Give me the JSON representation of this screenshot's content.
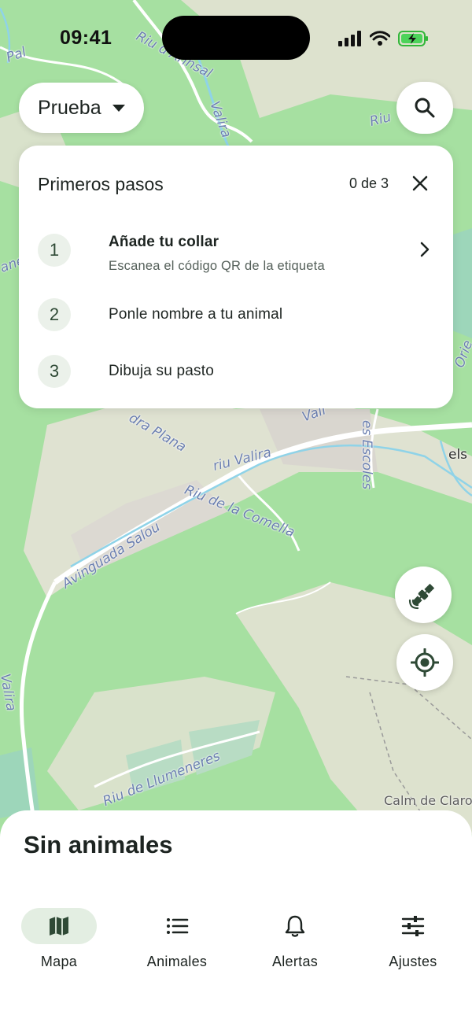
{
  "status_bar": {
    "time": "09:41"
  },
  "farm_selector": {
    "label": "Prueba"
  },
  "onboarding": {
    "title": "Primeros pasos",
    "progress": "0 de 3",
    "steps": [
      {
        "number": "1",
        "title": "Añade tu collar",
        "subtitle": "Escanea el código QR de la etiqueta"
      },
      {
        "number": "2",
        "title": "Ponle nombre a tu animal"
      },
      {
        "number": "3",
        "title": "Dibuja su pasto"
      }
    ]
  },
  "map": {
    "labels": {
      "l1": "Riu d'Arinsal",
      "l2": "Valira",
      "l3": "Riu",
      "l4": "Pal",
      "l5": "ane",
      "l6": "Orie",
      "l7": "dra Plana",
      "l8": "Vall",
      "l9": "es Escoles",
      "l10": "els",
      "l11": "riu Valira",
      "l12": "Riu de la Comella",
      "l13": "Avinguada Salou",
      "l14": "Valira",
      "l15": "Riu de Llumeneres",
      "l16": "Calm de Claro"
    }
  },
  "sheet": {
    "title": "Sin animales"
  },
  "tabs": [
    {
      "label": "Mapa",
      "icon": "map-icon",
      "active": true
    },
    {
      "label": "Animales",
      "icon": "list-icon",
      "active": false
    },
    {
      "label": "Alertas",
      "icon": "bell-icon",
      "active": false
    },
    {
      "label": "Ajustes",
      "icon": "sliders-icon",
      "active": false
    }
  ],
  "colors": {
    "map_green": "#a6e0a1",
    "map_beige": "#e6e2d6",
    "river": "#8fd3e8",
    "accent_green": "#2f4a36",
    "active_tab_bg": "#e3eee2"
  }
}
